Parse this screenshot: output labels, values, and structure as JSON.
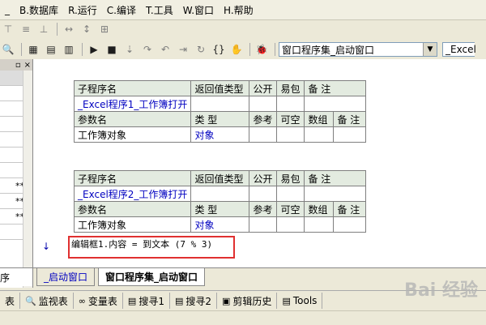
{
  "menu": [
    "B.数据库",
    "R.运行",
    "C.编译",
    "T.工具",
    "W.窗口",
    "H.帮助"
  ],
  "menu_prefix": "_",
  "combo_main": "窗口程序集_启动窗口",
  "combo_right": "_Excel",
  "left_panel": {
    "rows": [
      "",
      "",
      "",
      "",
      "",
      "",
      "",
      "**",
      "**",
      "**",
      ""
    ],
    "tab_label": "序"
  },
  "table1": {
    "header": [
      "子程序名",
      "返回值类型",
      "公开",
      "易包",
      "备 注"
    ],
    "name": "_Excel程序1_工作簿打开",
    "param_header": [
      "参数名",
      "类 型",
      "参考",
      "可空",
      "数组",
      "备 注"
    ],
    "param_row": [
      "工作簿对象",
      "对象"
    ]
  },
  "table2": {
    "header": [
      "子程序名",
      "返回值类型",
      "公开",
      "易包",
      "备 注"
    ],
    "name": "_Excel程序2_工作簿打开",
    "param_header": [
      "参数名",
      "类 型",
      "参考",
      "可空",
      "数组",
      "备 注"
    ],
    "param_row": [
      "工作簿对象",
      "对象"
    ]
  },
  "code_line": "编辑框1.内容 = 到文本 (7 % 3)",
  "tabs": [
    "_启动窗口",
    "窗口程序集_启动窗口"
  ],
  "bottom_tabs": [
    "表",
    "监视表",
    "变量表",
    "搜寻1",
    "搜寻2",
    "剪辑历史",
    "Tools"
  ],
  "watermark": "Bai 经验"
}
